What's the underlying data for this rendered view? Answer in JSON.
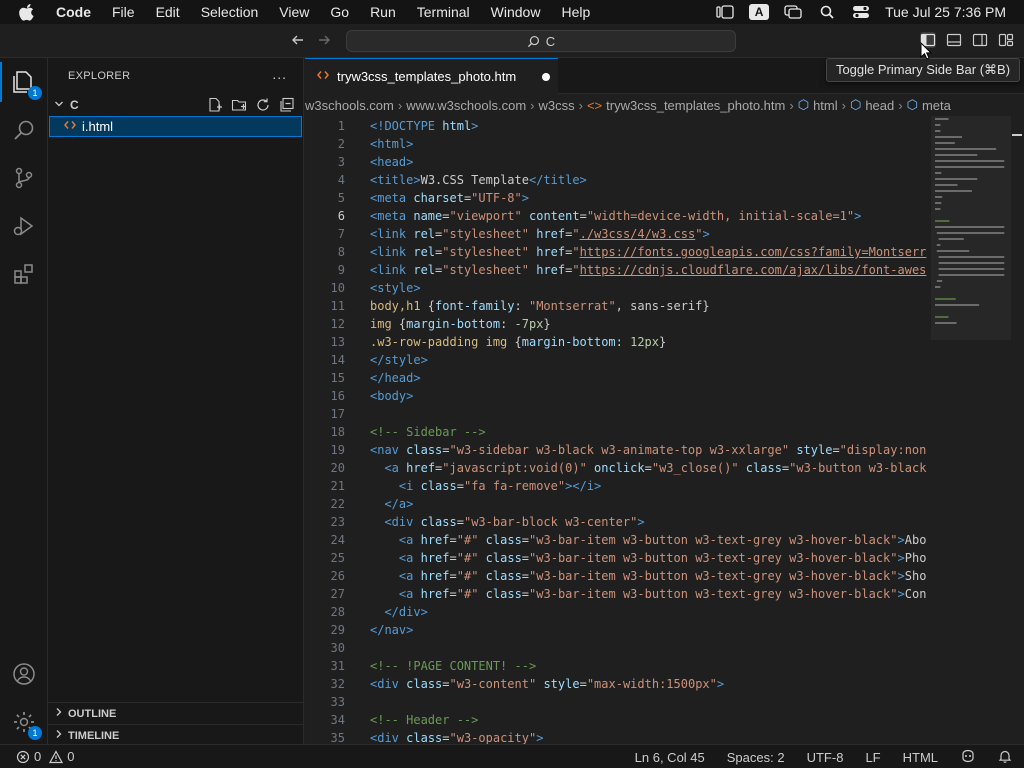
{
  "menubar": {
    "app": "Code",
    "items": [
      "File",
      "Edit",
      "Selection",
      "View",
      "Go",
      "Run",
      "Terminal",
      "Window",
      "Help"
    ],
    "input_badge": "A",
    "clock": "Tue Jul 25  7:36 PM"
  },
  "titlebar": {
    "command_center": "C"
  },
  "tooltip": "Toggle Primary Side Bar (⌘B)",
  "activitybar": {
    "explorer_badge": "1",
    "settings_badge": "1"
  },
  "sidebar": {
    "title": "EXPLORER",
    "more": "...",
    "folder": "C",
    "file": "i.html",
    "outline": "OUTLINE",
    "timeline": "TIMELINE"
  },
  "tab": {
    "icon": "<>",
    "label": "tryw3css_templates_photo.htm"
  },
  "breadcrumb": [
    "w3schools.com",
    "www.w3schools.com",
    "w3css",
    "tryw3css_templates_photo.htm",
    "html",
    "head",
    "meta"
  ],
  "editor": {
    "current_line": 6,
    "lines": [
      "<!DOCTYPE html>",
      "<html>",
      "<head>",
      "<title>W3.CSS Template</title>",
      "<meta charset=\"UTF-8\">",
      "<meta name=\"viewport\" content=\"width=device-width, initial-scale=1\">",
      "<link rel=\"stylesheet\" href=\"./w3css/4/w3.css\">",
      "<link rel=\"stylesheet\" href=\"https://fonts.googleapis.com/css?family=Montserr",
      "<link rel=\"stylesheet\" href=\"https://cdnjs.cloudflare.com/ajax/libs/font-awes",
      "<style>",
      "body,h1 {font-family: \"Montserrat\", sans-serif}",
      "img {margin-bottom: -7px}",
      ".w3-row-padding img {margin-bottom: 12px}",
      "</style>",
      "</head>",
      "<body>",
      "",
      "<!-- Sidebar -->",
      "<nav class=\"w3-sidebar w3-black w3-animate-top w3-xxlarge\" style=\"display:non",
      "  <a href=\"javascript:void(0)\" onclick=\"w3_close()\" class=\"w3-button w3-black",
      "    <i class=\"fa fa-remove\"></i>",
      "  </a>",
      "  <div class=\"w3-bar-block w3-center\">",
      "    <a href=\"#\" class=\"w3-bar-item w3-button w3-text-grey w3-hover-black\">Abo",
      "    <a href=\"#\" class=\"w3-bar-item w3-button w3-text-grey w3-hover-black\">Pho",
      "    <a href=\"#\" class=\"w3-bar-item w3-button w3-text-grey w3-hover-black\">Sho",
      "    <a href=\"#\" class=\"w3-bar-item w3-button w3-text-grey w3-hover-black\">Con",
      "  </div>",
      "</nav>",
      "",
      "<!-- !PAGE CONTENT! -->",
      "<div class=\"w3-content\" style=\"max-width:1500px\">",
      "",
      "<!-- Header -->",
      "<div class=\"w3-opacity\">"
    ]
  },
  "statusbar": {
    "errors": "0",
    "warnings": "0",
    "position": "Ln 6, Col 45",
    "spaces": "Spaces: 2",
    "encoding": "UTF-8",
    "eol": "LF",
    "language": "HTML"
  },
  "colors": {
    "accent": "#0078d4",
    "html_file_icon": "#e37933",
    "background": "#1e1e1e"
  }
}
